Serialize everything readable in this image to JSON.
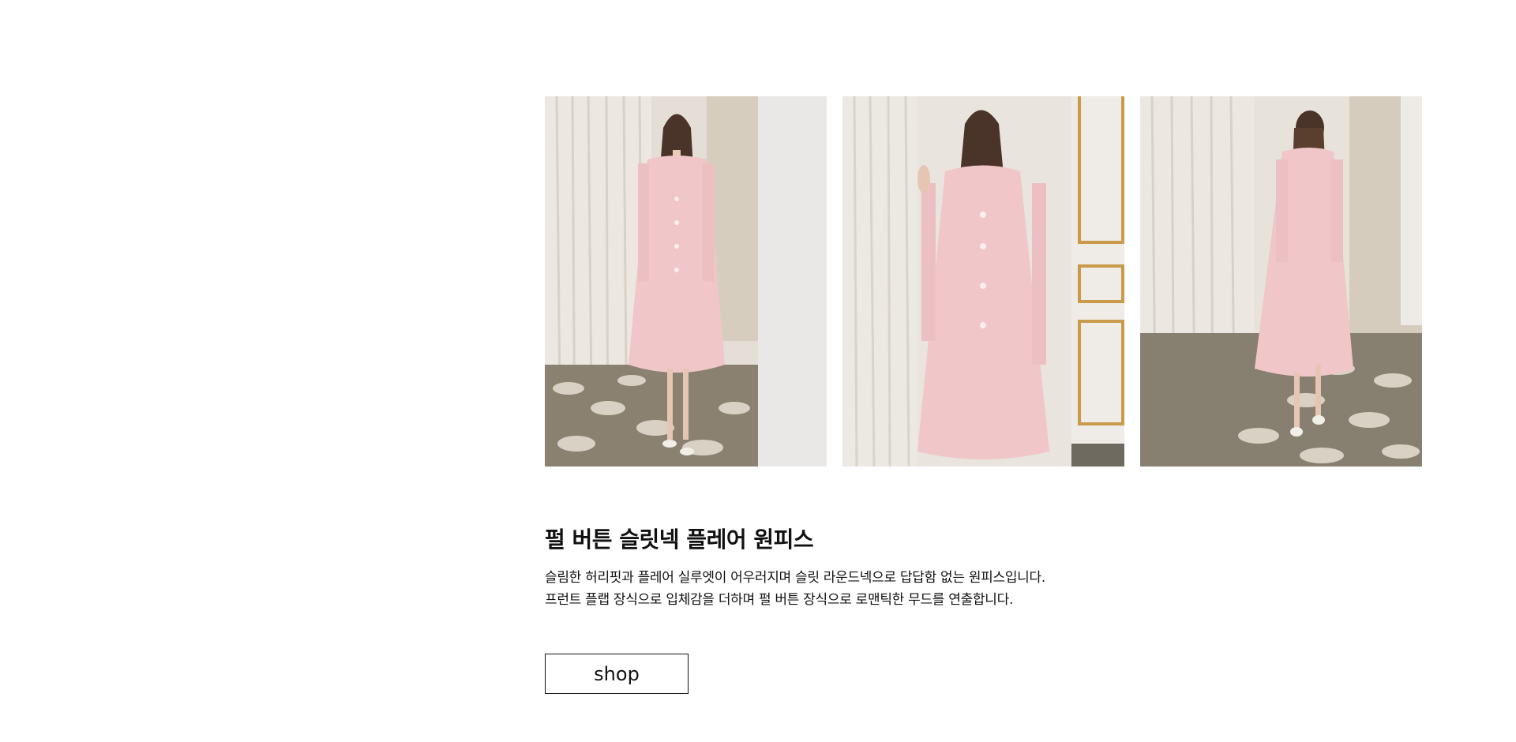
{
  "gallery": {
    "images": [
      {
        "alt": "front view"
      },
      {
        "alt": "front close view"
      },
      {
        "alt": "back view"
      }
    ]
  },
  "product": {
    "title": "펄 버튼 슬릿넥 플레어 원피스",
    "description_lines": [
      "슬림한 허리핏과 플레어 실루엣이 어우러지며 슬릿 라운드넥으로 답답함 없는 원피스입니다.",
      "프런트 플랩 장식으로 입체감을 더하며 펄 버튼 장식으로 로맨틱한 무드를 연출합니다."
    ],
    "shop_label": "shop"
  },
  "colors": {
    "dress": "#f0c6c8",
    "curtain": "#e8e2da",
    "wall": "#ddd6cc",
    "floor": "#7a7263",
    "gold": "#c89a4a"
  }
}
